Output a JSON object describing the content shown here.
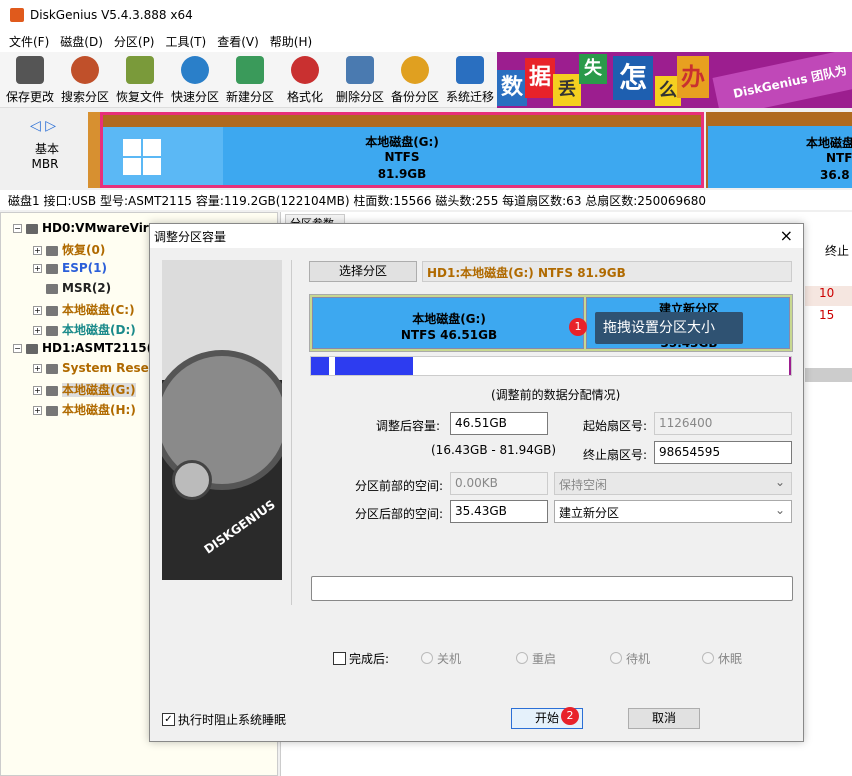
{
  "app": {
    "title": "DiskGenius V5.4.3.888 x64"
  },
  "menu": [
    "文件(F)",
    "磁盘(D)",
    "分区(P)",
    "工具(T)",
    "查看(V)",
    "帮助(H)"
  ],
  "toolbar": [
    "保存更改",
    "搜索分区",
    "恢复文件",
    "快速分区",
    "新建分区",
    "格式化",
    "删除分区",
    "备份分区",
    "系统迁移"
  ],
  "banner": {
    "chars": [
      "数",
      "据",
      "丢",
      "失",
      "怎",
      "么",
      "办"
    ],
    "text": "DiskGenius 团队为"
  },
  "diskmap": {
    "nav_label1": "基本",
    "nav_label2": "MBR",
    "part1": {
      "name": "本地磁盘(G:)",
      "fs": "NTFS",
      "size": "81.9GB"
    },
    "part2": {
      "name": "本地磁盘",
      "fs": "NTF",
      "size": "36.8"
    }
  },
  "disk_info": "磁盘1 接口:USB  型号:ASMT2115  容量:119.2GB(122104MB)  柱面数:15566  磁头数:255  每道扇区数:63  总扇区数:250069680",
  "tree": [
    {
      "label": "HD0:VMwareVir",
      "bold": true,
      "color": "#000"
    },
    {
      "label": "恢复(0)",
      "bold": true,
      "color": "#b06a00"
    },
    {
      "label": "ESP(1)",
      "bold": true,
      "color": "#2b5fd9"
    },
    {
      "label": "MSR(2)",
      "bold": true,
      "color": "#222"
    },
    {
      "label": "本地磁盘(C:)",
      "bold": true,
      "color": "#b06a00"
    },
    {
      "label": "本地磁盘(D:)",
      "bold": true,
      "color": "#1a8a8a"
    },
    {
      "label": "HD1:ASMT2115(",
      "bold": true,
      "color": "#000"
    },
    {
      "label": "System Reser",
      "bold": true,
      "color": "#b06a00"
    },
    {
      "label": "本地磁盘(G:)",
      "bold": true,
      "color": "#b06a00"
    },
    {
      "label": "本地磁盘(H:)",
      "bold": true,
      "color": "#b06a00"
    }
  ],
  "rightpane": {
    "tab": "分区参数",
    "col": "终止",
    "vals": [
      "10",
      "15"
    ]
  },
  "dialog": {
    "title": "调整分区容量",
    "close": "×",
    "select_btn": "选择分区",
    "selected_label": "HD1:本地磁盘(G:) NTFS 81.9GB",
    "bar_left": {
      "name": "本地磁盘(G:)",
      "fs": "NTFS 46.51GB"
    },
    "bar_right": {
      "name": "建立新分区",
      "size": "35.43GB"
    },
    "tooltip": "拖拽设置分区大小",
    "badge1": "1",
    "badge2": "2",
    "alloc_caption": "(调整前的数据分配情况)",
    "size_label": "调整后容量:",
    "size_value": "46.51GB",
    "range": "(16.43GB - 81.94GB)",
    "start_label": "起始扇区号:",
    "start_value": "1126400",
    "end_label": "终止扇区号:",
    "end_value": "98654595",
    "before_label": "分区前部的空间:",
    "before_value": "0.00KB",
    "before_opt": "保持空闲",
    "after_label": "分区后部的空间:",
    "after_value": "35.43GB",
    "after_opt": "建立新分区",
    "done_label": "完成后:",
    "radios": [
      "关机",
      "重启",
      "待机",
      "休眠"
    ],
    "sleep_label": "执行时阻止系统睡眠",
    "start_btn": "开始",
    "cancel_btn": "取消",
    "logo": "DISKGENIUS"
  },
  "colors": {
    "accent": "#2b6fd6",
    "bar_blue": "#3da8f0",
    "banner": "#9c1e8f"
  }
}
